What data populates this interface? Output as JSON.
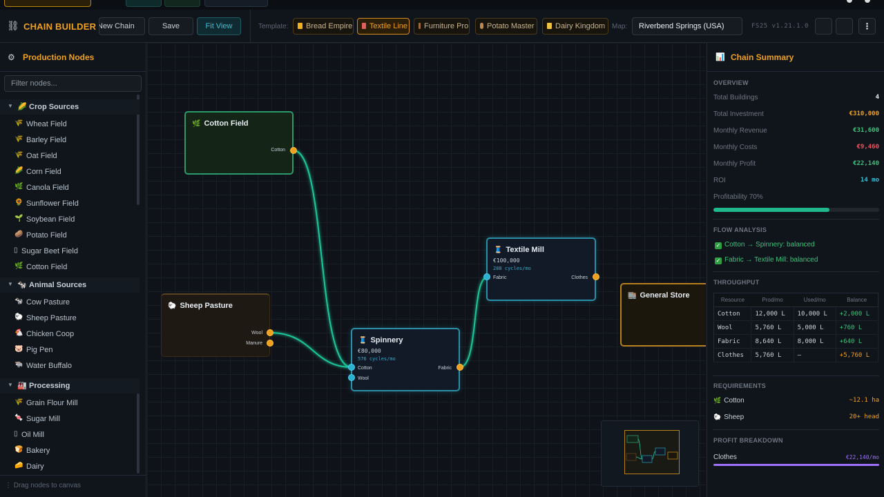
{
  "app": {
    "title": "CHAIN BUILDER",
    "brand_color": "#f0a020"
  },
  "header": {
    "new_label": "New Chain",
    "save_label": "Save",
    "fit_label": "Fit View",
    "template_label": "Template:",
    "templates": [
      {
        "label": "Bread Empire",
        "icon": "bread-icon"
      },
      {
        "label": "Textile Line",
        "icon": "spool-icon",
        "active": true
      },
      {
        "label": "Furniture Pro",
        "icon": "chair-icon"
      },
      {
        "label": "Potato Master",
        "icon": "potato-icon"
      },
      {
        "label": "Dairy Kingdom",
        "icon": "milk-icon"
      }
    ],
    "map_label": "Map:",
    "map_value": "Riverbend Springs (USA)",
    "version": "FS25  v1.21.1.0"
  },
  "sidebar": {
    "title": "Production Nodes",
    "filter_placeholder": "Filter nodes...",
    "footer": "⋮ Drag nodes to canvas",
    "categories": [
      {
        "label": "Crop Sources",
        "items": [
          "Wheat Field",
          "Barley Field",
          "Oat Field",
          "Corn Field",
          "Canola Field",
          "Sunflower Field",
          "Soybean Field",
          "Potato Field",
          "Sugar Beet Field",
          "Cotton Field"
        ]
      },
      {
        "label": "Animal Sources",
        "items": [
          "Cow Pasture",
          "Sheep Pasture",
          "Chicken Coop",
          "Pig Pen",
          "Water Buffalo"
        ]
      },
      {
        "label": "Processing",
        "items": [
          "Grain Flour Mill",
          "Sugar Mill",
          "Oil Mill",
          "Bakery",
          "Dairy"
        ]
      }
    ]
  },
  "canvas": {
    "nodes": {
      "cotton_field": {
        "title": "Cotton Field",
        "out": "Cotton"
      },
      "sheep_pasture": {
        "title": "Sheep Pasture",
        "out1": "Wool",
        "out2": "Manure"
      },
      "spinnery": {
        "title": "Spinnery",
        "cost": "€80,000",
        "cycles": "576 cycles/mo",
        "in1": "Cotton",
        "in2": "Wool",
        "out": "Fabric"
      },
      "textile_mill": {
        "title": "Textile Mill",
        "cost": "€100,000",
        "cycles": "288 cycles/mo",
        "in": "Fabric",
        "out": "Clothes"
      },
      "general_store": {
        "title": "General Store"
      }
    }
  },
  "summary": {
    "title": "Chain Summary",
    "overview_label": "OVERVIEW",
    "total_buildings_label": "Total Buildings",
    "total_buildings": "4",
    "total_investment_label": "Total Investment",
    "total_investment": "€310,000",
    "monthly_revenue_label": "Monthly Revenue",
    "monthly_revenue": "€31,600",
    "monthly_costs_label": "Monthly Costs",
    "monthly_costs": "€9,460",
    "monthly_profit_label": "Monthly Profit",
    "monthly_profit": "€22,140",
    "roi_label": "ROI",
    "roi": "14 mo",
    "profitability_label": "Profitability",
    "profitability": "70%",
    "profitability_fraction": 0.7,
    "flow_label": "FLOW ANALYSIS",
    "flows": [
      "Cotton → Spinnery: balanced",
      "Fabric → Textile Mill: balanced"
    ],
    "throughput_label": "THROUGHPUT",
    "throughput_headers": [
      "Resource",
      "Prod/mo",
      "Used/mo",
      "Balance"
    ],
    "throughput_rows": [
      [
        "Cotton",
        "12,000 L",
        "10,000 L",
        "+2,000 L"
      ],
      [
        "Wool",
        "5,760 L",
        "5,000 L",
        "+760 L"
      ],
      [
        "Fabric",
        "8,640 L",
        "8,000 L",
        "+640 L"
      ],
      [
        "Clothes",
        "5,760 L",
        "—",
        "+5,760 L"
      ]
    ],
    "requirements_label": "REQUIREMENTS",
    "req_cotton_label": "Cotton",
    "req_cotton": "~12.1 ha",
    "req_sheep_label": "Sheep",
    "req_sheep": "20+ head",
    "profit_breakdown_label": "PROFIT BREAKDOWN",
    "pb_clothes_label": "Clothes",
    "pb_clothes": "€22,140/mo",
    "pb_clothes_fraction": 1.0
  }
}
